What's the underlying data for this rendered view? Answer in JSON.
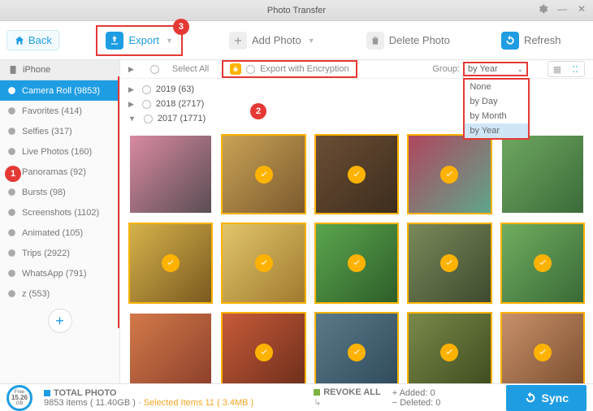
{
  "window": {
    "title": "Photo Transfer"
  },
  "topbar": {
    "back": "Back",
    "export": "Export",
    "add_photo": "Add Photo",
    "delete_photo": "Delete Photo",
    "refresh": "Refresh"
  },
  "annotations": {
    "b1": "1",
    "b2": "2",
    "b3": "3"
  },
  "sidebar": {
    "device": "iPhone",
    "items": [
      {
        "label": "Camera Roll (9853)",
        "active": true
      },
      {
        "label": "Favorites (414)"
      },
      {
        "label": "Selfies (317)"
      },
      {
        "label": "Live Photos (160)"
      },
      {
        "label": "Panoramas (92)"
      },
      {
        "label": "Bursts (98)"
      },
      {
        "label": "Screenshots (1102)"
      },
      {
        "label": "Animated (105)"
      },
      {
        "label": "Trips (2922)"
      },
      {
        "label": "WhatsApp (791)"
      },
      {
        "label": "z (553)"
      }
    ]
  },
  "filter": {
    "select_all": "Select All",
    "encrypt": "Export with Encryption",
    "group_label": "Group:",
    "group_value": "by Year",
    "group_options": [
      "None",
      "by Day",
      "by Month",
      "by Year"
    ]
  },
  "years": [
    {
      "label": "2019 (63)",
      "open": false
    },
    {
      "label": "2018 (2717)",
      "open": false
    },
    {
      "label": "2017 (1771)",
      "open": true
    }
  ],
  "thumbs": [
    {
      "c1": "#d88aa0",
      "c2": "#5a4d54",
      "sel": false
    },
    {
      "c1": "#caa256",
      "c2": "#7b5a2e",
      "sel": true
    },
    {
      "c1": "#6b4e34",
      "c2": "#3d2d1e",
      "sel": true
    },
    {
      "c1": "#b0465f",
      "c2": "#5ea68a",
      "sel": true
    },
    {
      "c1": "#6fa760",
      "c2": "#3b6b3a",
      "sel": false
    },
    {
      "c1": "#d6b24a",
      "c2": "#7a5a20",
      "sel": true
    },
    {
      "c1": "#e2c56b",
      "c2": "#a07a2e",
      "sel": true
    },
    {
      "c1": "#5aa64d",
      "c2": "#2e5e2a",
      "sel": true
    },
    {
      "c1": "#7a8a5a",
      "c2": "#3e4a2e",
      "sel": true
    },
    {
      "c1": "#6fae5f",
      "c2": "#3a6a38",
      "sel": true
    },
    {
      "c1": "#d47a4a",
      "c2": "#8a3e2a",
      "sel": false
    },
    {
      "c1": "#c95a3a",
      "c2": "#6a2e1a",
      "sel": true
    },
    {
      "c1": "#5a7a8a",
      "c2": "#2e4a5a",
      "sel": true
    },
    {
      "c1": "#7a8a4a",
      "c2": "#3e4a1e",
      "sel": true
    },
    {
      "c1": "#c8906a",
      "c2": "#7a4e2e",
      "sel": true
    }
  ],
  "status": {
    "free_value": "15.26",
    "free_unit": "GB",
    "free_label": "Free",
    "total_label": "TOTAL PHOTO",
    "total_detail": "9853 items ( 11.40GB )",
    "selected": "Selected Items 11 ( 3.4MB )",
    "revoke": "REVOKE ALL",
    "added": "Added: 0",
    "deleted": "Deleted: 0",
    "sync": "Sync"
  }
}
